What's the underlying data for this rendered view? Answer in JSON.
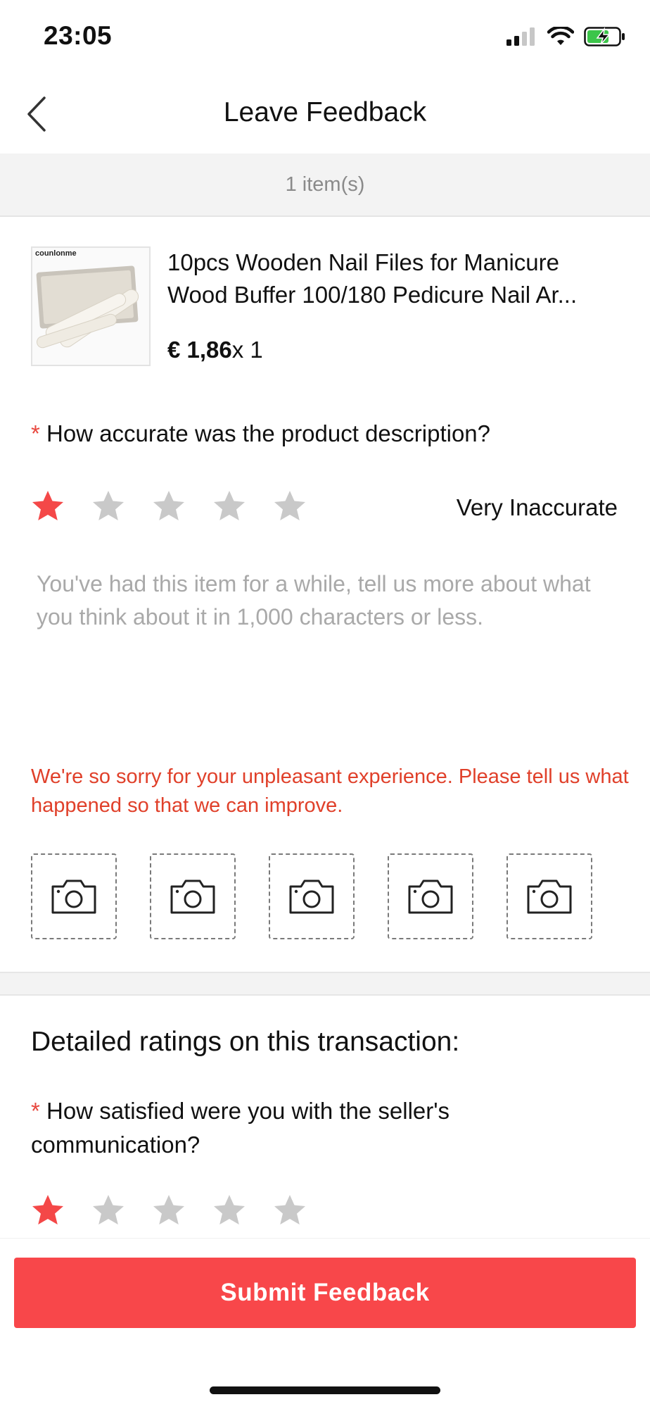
{
  "status_bar": {
    "time": "23:05"
  },
  "nav": {
    "title": "Leave Feedback"
  },
  "item_count": "1 item(s)",
  "product": {
    "brand_mark": "counlonme",
    "title": "10pcs Wooden Nail Files for Manicure Wood Buffer 100/180 Pedicure Nail Ar...",
    "price": "€ 1,86",
    "quantity": "x 1"
  },
  "accuracy": {
    "required_mark": "*",
    "question": "How accurate was the product description?",
    "rating": 1,
    "max_rating": 5,
    "rating_label": "Very Inaccurate"
  },
  "review": {
    "placeholder": "You've had this item for a while, tell us more about what you think about it in 1,000 characters or less."
  },
  "sorry_message": "We're so sorry for your unpleasant experience. Please tell us what happened so that we can improve.",
  "photo_slots": 5,
  "detailed": {
    "heading": "Detailed ratings on this transaction:",
    "required_mark": "*",
    "question": "How satisfied were you with the seller's communication?",
    "rating": 1,
    "max_rating": 5
  },
  "submit_label": "Submit Feedback",
  "colors": {
    "accent": "#f8474a",
    "star_active": "#f44848",
    "star_inactive": "#c9c9c9",
    "warning_text": "#e0402a"
  }
}
